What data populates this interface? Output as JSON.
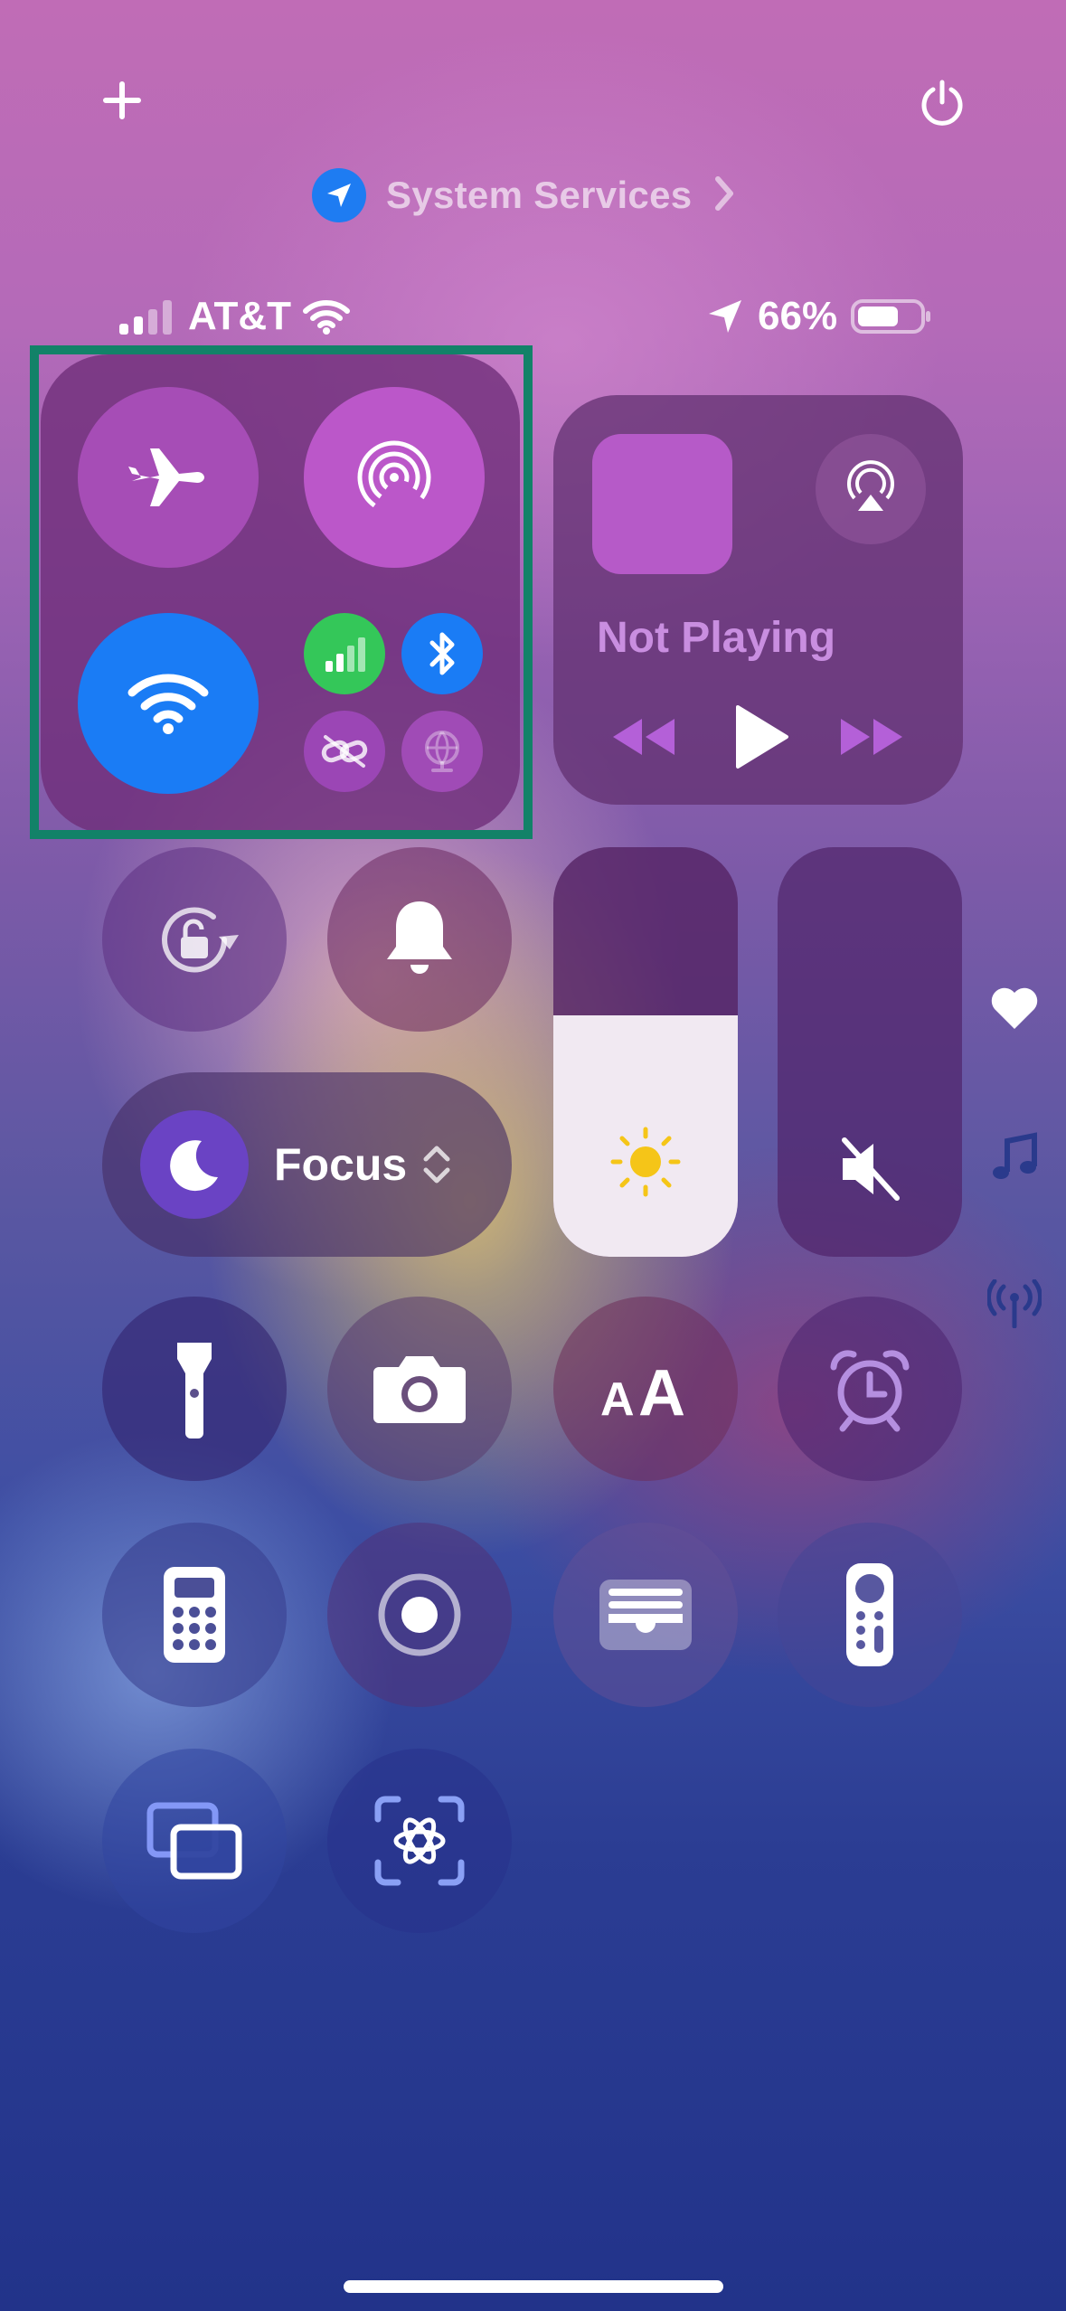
{
  "top_bar": {
    "add_icon": "plus-icon",
    "power_icon": "power-icon"
  },
  "location_indicator": {
    "label": "System Services",
    "icon": "location-arrow-icon",
    "chevron": "chevron-right-icon"
  },
  "status_bar": {
    "carrier": "AT&T",
    "signal_bars": 2,
    "battery_percent": "66%",
    "battery_level": 0.66
  },
  "connectivity": {
    "airplane_mode": {
      "icon": "airplane-icon",
      "active": true
    },
    "airdrop": {
      "icon": "airdrop-icon",
      "active": true
    },
    "wifi": {
      "icon": "wifi-icon",
      "active": true,
      "color": "#1a7cf5"
    },
    "cellular": {
      "icon": "cellular-icon",
      "active": true,
      "color": "#34c759"
    },
    "bluetooth": {
      "icon": "bluetooth-icon",
      "active": true,
      "color": "#1a7cf5"
    },
    "hotspot": {
      "icon": "hotspot-link-icon",
      "active": false
    },
    "vpn": {
      "icon": "vpn-globe-icon",
      "active": false
    }
  },
  "now_playing": {
    "status": "Not Playing",
    "airplay_icon": "airplay-icon",
    "controls": [
      "rewind-icon",
      "play-icon",
      "fast-forward-icon"
    ]
  },
  "controls": {
    "orientation_lock": "orientation-lock-icon",
    "silent_mode": "bell-icon",
    "focus": {
      "label": "Focus",
      "icon": "moon-icon"
    },
    "brightness": {
      "icon": "sun-icon",
      "level": 0.59
    },
    "volume": {
      "icon": "speaker-muted-icon",
      "level": 0.0
    }
  },
  "tiles": [
    "flashlight-icon",
    "camera-icon",
    "text-size-icon",
    "alarm-icon",
    "calculator-icon",
    "screen-recording-icon",
    "wallet-icon",
    "remote-icon",
    "screen-mirroring-icon",
    "visual-intelligence-icon"
  ],
  "side_pages": [
    "heart-icon",
    "music-note-icon",
    "antenna-icon"
  ],
  "accent_colors": {
    "highlight_border": "#128268",
    "sun": "#f5c518",
    "location_badge": "#1e7cf2"
  }
}
